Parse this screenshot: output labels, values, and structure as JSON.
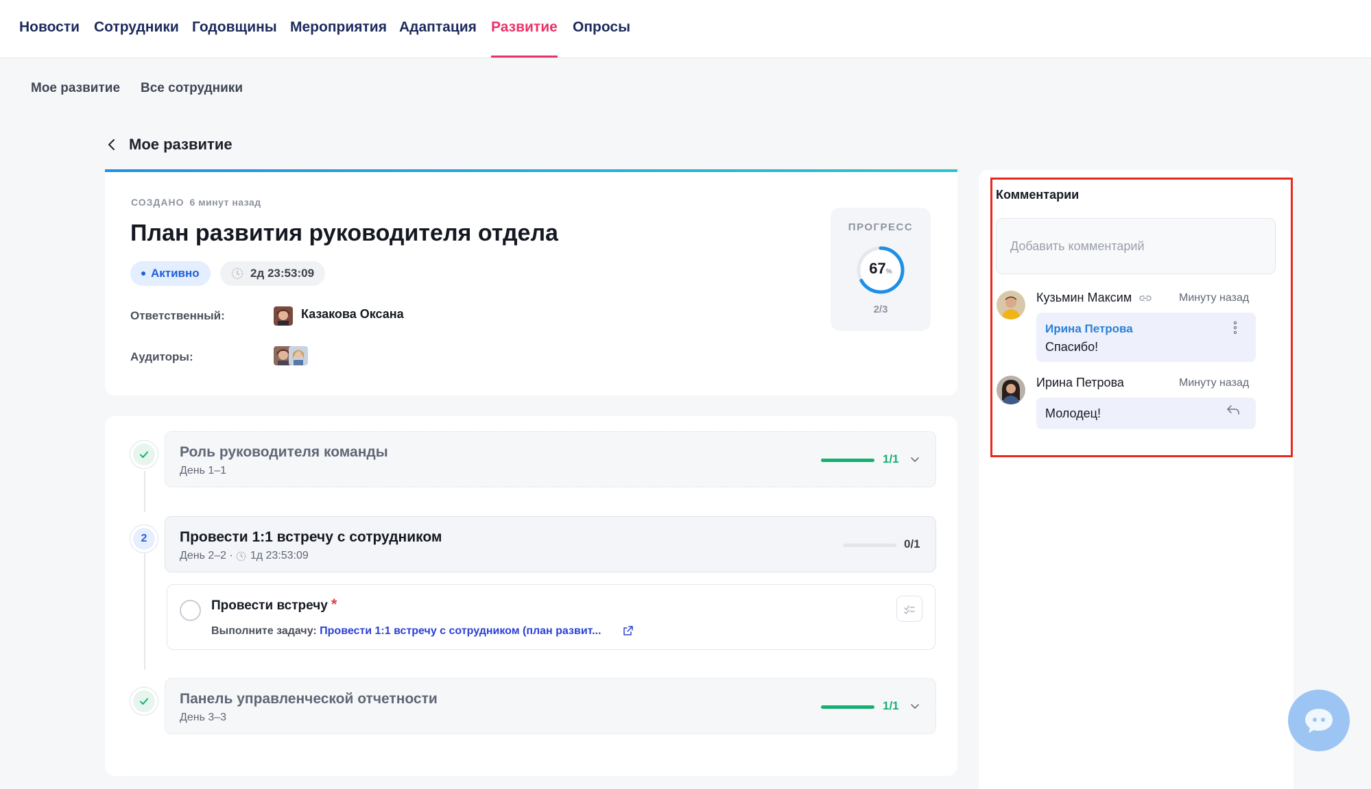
{
  "nav": {
    "tabs": [
      {
        "label": "Новости"
      },
      {
        "label": "Сотрудники"
      },
      {
        "label": "Годовщины"
      },
      {
        "label": "Мероприятия"
      },
      {
        "label": "Адаптация"
      },
      {
        "label": "Развитие",
        "active": true
      },
      {
        "label": "Опросы"
      }
    ]
  },
  "subnav": {
    "tabs": [
      {
        "label": "Мое развитие"
      },
      {
        "label": "Все сотрудники"
      }
    ]
  },
  "back": {
    "label": "Мое развитие"
  },
  "plan": {
    "created_label": "СОЗДАНО",
    "created_ago": "6 минут назад",
    "title": "План развития руководителя отдела",
    "status": "Активно",
    "timer": "2д 23:53:09",
    "responsible_label": "Ответственный:",
    "responsible_name": "Казакова Оксана",
    "auditors_label": "Аудиторы:",
    "progress": {
      "label": "ПРОГРЕСС",
      "percent": "67",
      "percent_sign": "%",
      "percent_value": 0.67,
      "count": "2/3"
    }
  },
  "stages": [
    {
      "index": "",
      "done": true,
      "title": "Роль руководителя команды",
      "day": "День 1–1",
      "count": "1/1",
      "fraction": 1
    },
    {
      "index": "2",
      "done": false,
      "title": "Провести 1:1 встречу с сотрудником",
      "day": "День 2–2 ·",
      "timer": "1д 23:53:09",
      "count": "0/1",
      "fraction": 0,
      "task": {
        "title": "Провести встречу",
        "required_mark": "*",
        "desc_label": "Выполните задачу:",
        "link": "Провести 1:1 встречу с сотрудником (план развит..."
      }
    },
    {
      "index": "",
      "done": true,
      "title": "Панель управленческой отчетности",
      "day": "День 3–3",
      "count": "1/1",
      "fraction": 1
    }
  ],
  "comments": {
    "title": "Комментарии",
    "input_placeholder": "Добавить комментарий",
    "items": [
      {
        "author": "Кузьмин Максим",
        "time": "Минуту назад",
        "mention": "Ирина Петрова",
        "text": "Спасибо!"
      },
      {
        "author": "Ирина Петрова",
        "time": "Минуту назад",
        "text": "Молодец!"
      }
    ]
  },
  "colors": {
    "accent": "#e8336a",
    "nav_text": "#1c2a5c",
    "progress_ring": "#1e8fe6",
    "success": "#14b071",
    "link": "#2a3fd6",
    "highlight_box": "#e8281c"
  },
  "icons": [
    "chevron-left-icon",
    "clock-icon",
    "check-icon",
    "chevron-down-icon",
    "external-link-icon",
    "checklist-icon",
    "link-icon",
    "more-vertical-icon",
    "reply-icon",
    "chat-icon"
  ]
}
